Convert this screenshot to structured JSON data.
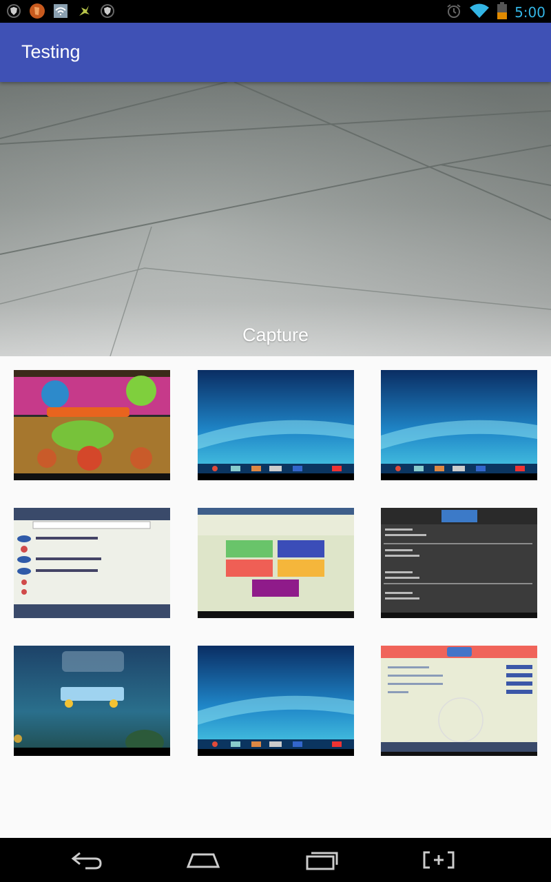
{
  "status_bar": {
    "time": "5:00",
    "left_icons": [
      "shield-icon",
      "app-notification-icon",
      "wifi-notification-icon",
      "puzzle-icon",
      "shield-icon"
    ],
    "right_icons": [
      "alarm-icon",
      "wifi-icon",
      "battery-icon"
    ]
  },
  "app_bar": {
    "title": "Testing"
  },
  "preview": {
    "capture_label": "Capture"
  },
  "gallery": {
    "items": [
      {
        "name": "news-game-screenshot"
      },
      {
        "name": "home-screen-screenshot"
      },
      {
        "name": "home-screen-screenshot"
      },
      {
        "name": "behavior-list-screenshot"
      },
      {
        "name": "how-do-you-feel-screenshot"
      },
      {
        "name": "notification-screenshot"
      },
      {
        "name": "angry-birds-screenshot"
      },
      {
        "name": "home-screen-screenshot"
      },
      {
        "name": "behavior-home-screenshot"
      }
    ]
  },
  "nav_bar": {
    "buttons": [
      "back-icon",
      "home-icon",
      "recents-icon",
      "screenshot-icon"
    ]
  },
  "colors": {
    "app_bar": "#3f51b5",
    "status_accent": "#33b5e5",
    "background": "#fafafa"
  }
}
